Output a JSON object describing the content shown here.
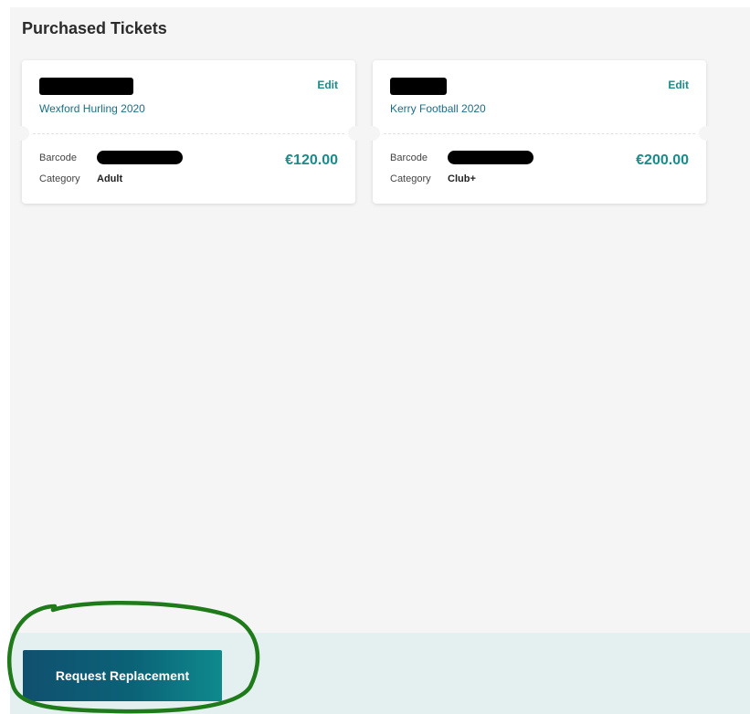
{
  "section": {
    "title": "Purchased Tickets"
  },
  "tickets": [
    {
      "event": "Wexford Hurling 2020",
      "edit_label": "Edit",
      "barcode_label": "Barcode",
      "category_label": "Category",
      "category": "Adult",
      "price": "€120.00"
    },
    {
      "event": "Kerry Football 2020",
      "edit_label": "Edit",
      "barcode_label": "Barcode",
      "category_label": "Category",
      "category": "Club+",
      "price": "€200.00"
    }
  ],
  "footer": {
    "request_button_label": "Request Replacement"
  },
  "colors": {
    "accent": "#1d8a8a",
    "link": "#1b6f84",
    "button_gradient_start": "#10506f",
    "button_gradient_end": "#0f8a8d",
    "annotation": "#1f7a1a"
  }
}
